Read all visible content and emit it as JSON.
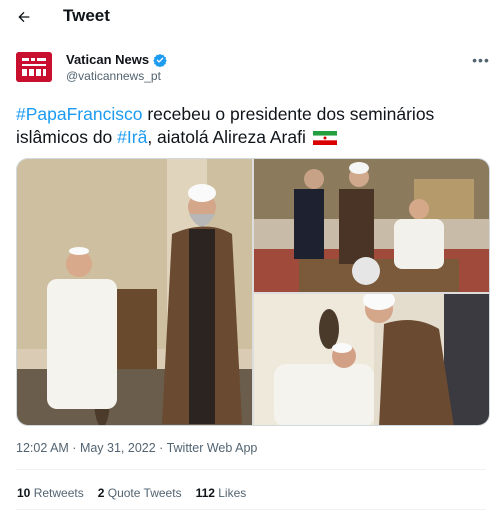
{
  "header": {
    "title": "Tweet",
    "back_icon": "arrow-left-icon"
  },
  "author": {
    "name": "Vatican News",
    "handle": "@vaticannews_pt",
    "verified": true,
    "verified_color": "#1d9bf0",
    "avatar_color": "#c8102e"
  },
  "more_icon": "more-horizontal-icon",
  "tweet": {
    "hashtag1": "#PapaFrancisco",
    "text1": " recebeu o presidente dos seminários islâmicos do ",
    "hashtag2": "#Irã",
    "text2": ", aiatolá Alireza Arafi ",
    "flag": "iran-flag-emoji",
    "hashtag_color": "#1d9bf0"
  },
  "media": {
    "count": 3,
    "photos": [
      "photo-pope-and-cleric-standing",
      "photo-meeting-at-desk",
      "photo-pope-kissing-hand"
    ]
  },
  "meta": {
    "time": "12:02 AM",
    "separator1": " · ",
    "date": "May 31, 2022",
    "separator2": " · ",
    "source": "Twitter Web App"
  },
  "stats": {
    "retweets_count": "10",
    "retweets_label": " Retweets",
    "quotes_count": "2",
    "quotes_label": " Quote Tweets",
    "likes_count": "112",
    "likes_label": " Likes"
  }
}
